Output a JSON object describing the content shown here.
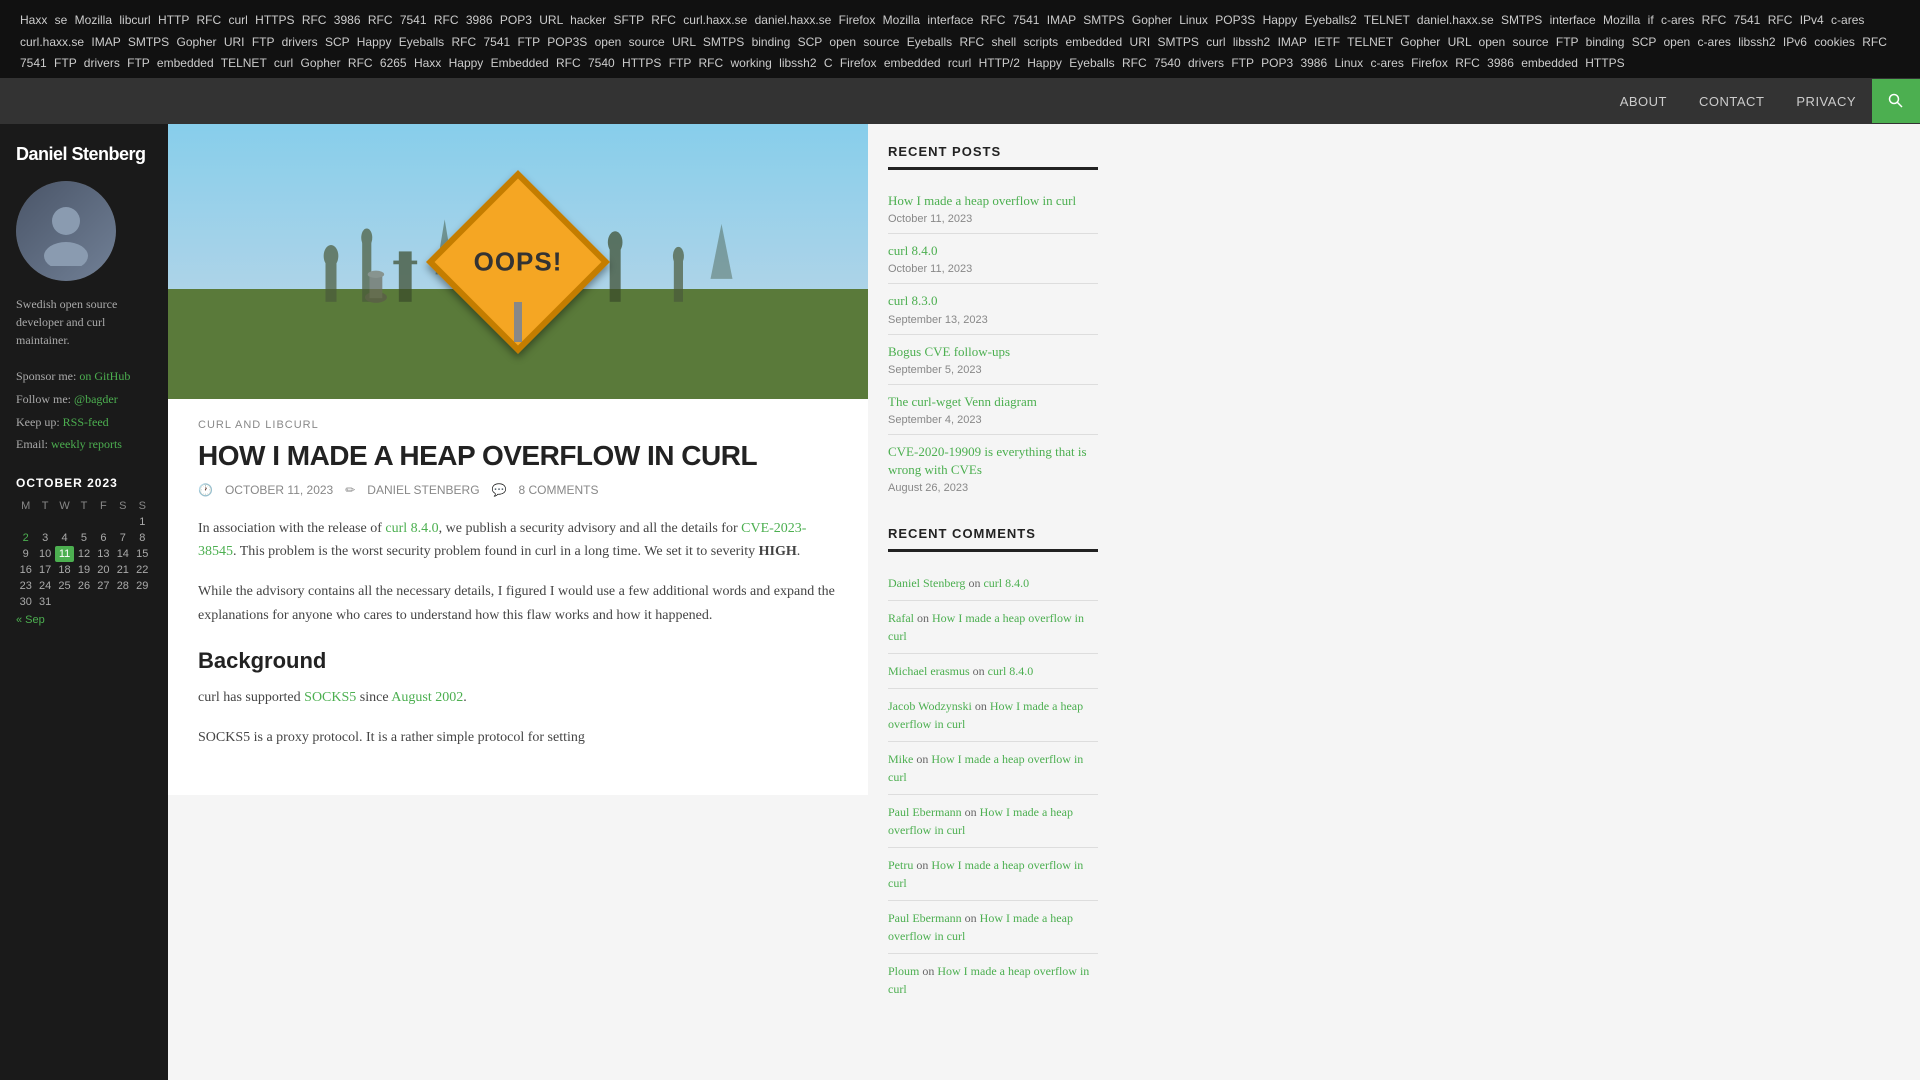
{
  "tag_cloud": "Haxx se Mozilla libcurl HTTP RFC curl HTTPS RFC 3986 RFC 7541 RFC 3986 POP3 URL hacker SFTP RFC curl.haxx.se daniel.haxx.se Firefox Mozilla interface RFC 7541 IMAP SMTPS Gopher Linux POP3S Happy Eyeballs2 TELNET daniel.haxx.se SMTPS interface Mozilla if c-ares RFC 7541 RFC IPv4 c-ares curl.haxx.se IMAP SMTPS Gopher URI FTP drivers SCP Happy Eyeballs RFC 7541 FTP POP3S open source URL SMTPS binding SCP open source Eyeballs RFC shell scripts embedded URI SMTPS curl libssh2 IMAP IETF TELNET Gopher URL open source FTP binding SCP open c-ares libssh2 IPv6 cookies RFC 7541 FTP drivers FTP embedded TELNET curl Gopher RFC 6265 Haxx Happy Embedded RFC 7540 HTTPS FTP RFC working libssh2 C Firefox embedded rcurl HTTP/2 Happy Eyeballs RFC 7540 drivers FTP POP3 3986 Linux c-ares Firefox RFC 3986 embedded HTTPS",
  "nav": {
    "about": "ABOUT",
    "contact": "CONTACT",
    "privacy": "PRIVACY",
    "search_aria": "Search"
  },
  "sidebar": {
    "title": "Daniel Stenberg",
    "bio": "Swedish open source developer and curl maintainer.",
    "sponsor_label": "Sponsor me:",
    "sponsor_link_text": "on GitHub",
    "sponsor_link_href": "#",
    "follow_label": "Follow me:",
    "follow_link_text": "@bagder",
    "follow_link_href": "#",
    "keepup_label": "Keep up:",
    "keepup_link_text": "RSS-feed",
    "keepup_link_href": "#",
    "email_label": "Email:",
    "email_link_text": "weekly reports",
    "email_link_href": "#",
    "calendar": {
      "title": "OCTOBER 2023",
      "headers": [
        "M",
        "T",
        "W",
        "T",
        "F",
        "S",
        "S"
      ],
      "weeks": [
        [
          "",
          "",
          "",
          "",
          "",
          "",
          "1"
        ],
        [
          "2",
          "3",
          "4",
          "5",
          "6",
          "7",
          "8"
        ],
        [
          "9",
          "10",
          "11",
          "12",
          "13",
          "14",
          "15"
        ],
        [
          "16",
          "17",
          "18",
          "19",
          "20",
          "21",
          "22"
        ],
        [
          "23",
          "24",
          "25",
          "26",
          "27",
          "28",
          "29"
        ],
        [
          "30",
          "31",
          "",
          "",
          "",
          "",
          ""
        ]
      ],
      "today_week": 2,
      "today_day": 2,
      "prev_label": "« Sep"
    }
  },
  "article": {
    "category": "CURL AND LIBCURL",
    "title": "HOW I MADE A HEAP OVERFLOW IN CURL",
    "meta_date": "OCTOBER 11, 2023",
    "meta_author": "DANIEL STENBERG",
    "meta_comments": "8 COMMENTS",
    "body_p1_before": "In association with the release of ",
    "body_p1_link1_text": "curl 8.4.0",
    "body_p1_link1_href": "#",
    "body_p1_middle": ", we publish a security advisory and all the details for ",
    "body_p1_link2_text": "CVE-2023-38545",
    "body_p1_link2_href": "#",
    "body_p1_after": ". This problem is the worst security problem found in curl in a long time. We set it to severity ",
    "body_p1_strong": "HIGH",
    "body_p1_end": ".",
    "body_p2": "While the advisory contains all the necessary details, I figured I would use a few additional words and expand the explanations for anyone who cares to understand how this flaw works and how it happened.",
    "body_h2": "Background",
    "body_p3_before": "curl has supported ",
    "body_p3_link1_text": "SOCKS5",
    "body_p3_link1_href": "#",
    "body_p3_middle": " since ",
    "body_p3_link2_text": "August 2002",
    "body_p3_link2_href": "#",
    "body_p3_end": ".",
    "body_p4": "SOCKS5 is a proxy protocol. It is a rather simple protocol for setting"
  },
  "right_sidebar": {
    "recent_posts_title": "RECENT POSTS",
    "recent_posts": [
      {
        "title": "How I made a heap overflow in curl",
        "date": "October 11, 2023",
        "href": "#"
      },
      {
        "title": "curl 8.4.0",
        "date": "October 11, 2023",
        "href": "#"
      },
      {
        "title": "curl 8.3.0",
        "date": "September 13, 2023",
        "href": "#"
      },
      {
        "title": "Bogus CVE follow-ups",
        "date": "September 5, 2023",
        "href": "#"
      },
      {
        "title": "The curl-wget Venn diagram",
        "date": "September 4, 2023",
        "href": "#"
      },
      {
        "title": "CVE-2020-19909 is everything that is wrong with CVEs",
        "date": "August 26, 2023",
        "href": "#"
      }
    ],
    "recent_comments_title": "RECENT COMMENTS",
    "recent_comments": [
      {
        "commenter": "Daniel Stenberg",
        "on_text": "on",
        "link_text": "curl 8.4.0",
        "href": "#"
      },
      {
        "commenter": "Rafal",
        "on_text": "on",
        "link_text": "How I made a heap overflow in curl",
        "href": "#"
      },
      {
        "commenter": "Michael erasmus",
        "on_text": "on",
        "link_text": "curl 8.4.0",
        "href": "#"
      },
      {
        "commenter": "Jacob Wodzynski",
        "on_text": "on",
        "link_text": "How I made a heap overflow in curl",
        "href": "#"
      },
      {
        "commenter": "Mike",
        "on_text": "on",
        "link_text": "How I made a heap overflow in curl",
        "href": "#"
      },
      {
        "commenter": "Paul Ebermann",
        "on_text": "on",
        "link_text": "How I made a heap overflow in curl",
        "href": "#"
      },
      {
        "commenter": "Petru",
        "on_text": "on",
        "link_text": "How I made a heap overflow in curl",
        "href": "#"
      },
      {
        "commenter": "Paul Ebermann",
        "on_text": "on",
        "link_text": "How I made a heap overflow in curl",
        "href": "#"
      },
      {
        "commenter": "Ploum",
        "on_text": "on",
        "link_text": "How I made a heap overflow in curl",
        "href": "#"
      }
    ]
  },
  "colors": {
    "accent": "#4caf50",
    "dark_bg": "#1a1a1a",
    "nav_bg": "#333",
    "tag_cloud_bg": "#111"
  }
}
